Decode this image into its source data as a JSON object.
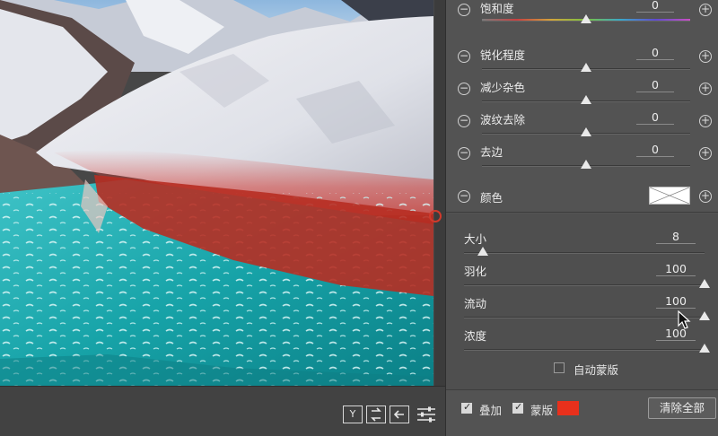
{
  "panel": {
    "saturation": {
      "label": "饱和度",
      "value": "0",
      "level": 0.5
    },
    "details": [
      {
        "name": "sharpness",
        "label": "锐化程度",
        "value": "0",
        "level": 0.5
      },
      {
        "name": "noise",
        "label": "减少杂色",
        "value": "0",
        "level": 0.5
      },
      {
        "name": "moire",
        "label": "波纹去除",
        "value": "0",
        "level": 0.5
      },
      {
        "name": "defringe",
        "label": "去边",
        "value": "0",
        "level": 0.5
      }
    ],
    "color": {
      "label": "颜色",
      "swatch": "#ffffff"
    },
    "brush": [
      {
        "name": "size",
        "label": "大小",
        "value": "8",
        "level": 0.08
      },
      {
        "name": "feather",
        "label": "羽化",
        "value": "100",
        "level": 1.0
      },
      {
        "name": "flow",
        "label": "流动",
        "value": "100",
        "level": 1.0
      },
      {
        "name": "density",
        "label": "浓度",
        "value": "100",
        "level": 1.0
      }
    ],
    "auto_mask": {
      "label": "自动蒙版",
      "checked": false
    },
    "overlay": {
      "label": "叠加",
      "checked": true
    },
    "mask": {
      "label": "蒙版",
      "checked": true,
      "color": "#e8301c"
    },
    "clear_all_label": "清除全部"
  },
  "canvas_toolbar": {
    "view_mode_label": "Y"
  },
  "colors": {
    "mask_overlay": "#c8281e",
    "panel_bg": "#535353",
    "water": "#1aa7a8"
  }
}
